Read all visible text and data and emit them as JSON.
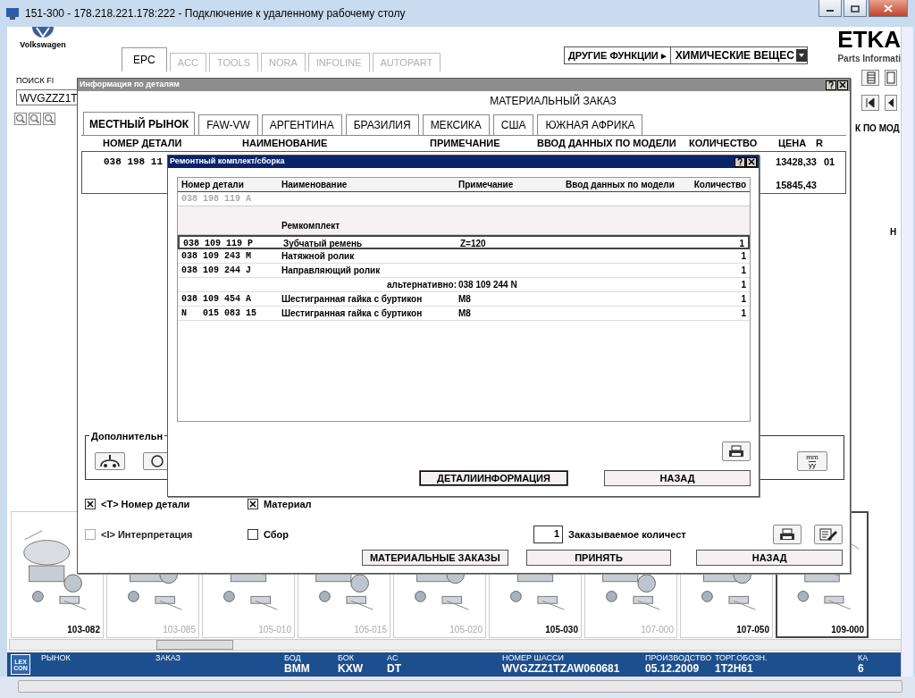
{
  "window": {
    "title": "151-300 - 178.218.221.178:222 - Подключение к удаленному рабочему столу"
  },
  "brand": {
    "name": "Volkswagen",
    "logo_text": "ETKA",
    "subtitle": "Parts Informati"
  },
  "app_tabs": [
    {
      "label": "EPC",
      "selected": true,
      "disabled": false
    },
    {
      "label": "ACC",
      "selected": false,
      "disabled": true
    },
    {
      "label": "TOOLS",
      "selected": false,
      "disabled": true
    },
    {
      "label": "NORA",
      "selected": false,
      "disabled": true
    },
    {
      "label": "INFOLINE",
      "selected": false,
      "disabled": true
    },
    {
      "label": "AUTOPART",
      "selected": false,
      "disabled": true
    }
  ],
  "other_functions": {
    "label": "ДРУГИЕ ФУНКЦИИ ▸",
    "value": "ХИМИЧЕСКИЕ ВЕЩЕС"
  },
  "search": {
    "label": "ПОИСК FI",
    "value": "WVGZZZ1T"
  },
  "right_panel": {
    "header": "К ПО МОД",
    "text": "Н"
  },
  "thumbnails": [
    {
      "label": "103-082",
      "dimmed": false,
      "selected": false
    },
    {
      "label": "103-085",
      "dimmed": true,
      "selected": false
    },
    {
      "label": "105-010",
      "dimmed": true,
      "selected": false
    },
    {
      "label": "105-015",
      "dimmed": true,
      "selected": false
    },
    {
      "label": "105-020",
      "dimmed": true,
      "selected": false
    },
    {
      "label": "105-030",
      "dimmed": false,
      "selected": false
    },
    {
      "label": "107-000",
      "dimmed": true,
      "selected": false
    },
    {
      "label": "107-050",
      "dimmed": false,
      "selected": false
    },
    {
      "label": "109-000",
      "dimmed": false,
      "selected": true
    }
  ],
  "status_bar": {
    "logo": [
      "LEX",
      "CON"
    ],
    "fields": [
      {
        "label": "РЫНОК"
      },
      {
        "label": "ЗАКАЗ"
      },
      {
        "label": "БОД",
        "value": "BMM"
      },
      {
        "label": "БОК",
        "value": "KXW"
      },
      {
        "label": "AC",
        "value": "DT"
      },
      {
        "label": "НОМЕР ШАССИ",
        "value": "WVGZZZ1TZAW060681"
      },
      {
        "label": "ПРОИЗВОДСТВО",
        "value": "05.12.2009"
      },
      {
        "label": "ТОРГ.ОБОЗН.",
        "value": "1T2H61"
      },
      {
        "label": "КА",
        "value": "6"
      }
    ]
  },
  "details_dialog": {
    "title": "Информация по деталям",
    "heading": "МАТЕРИАЛЬНЫЙ ЗАКАЗ",
    "tabs": [
      {
        "label": "МЕСТНЫЙ РЫНОК",
        "selected": true
      },
      {
        "label": "FAW-VW",
        "selected": false
      },
      {
        "label": "АРГЕНТИНА",
        "selected": false
      },
      {
        "label": "БРАЗИЛИЯ",
        "selected": false
      },
      {
        "label": "МЕКСИКА",
        "selected": false
      },
      {
        "label": "США",
        "selected": false
      },
      {
        "label": "ЮЖНАЯ АФРИКА",
        "selected": false
      }
    ],
    "columns": [
      "НОМЕР ДЕТАЛИ",
      "НАИМЕНОВАНИЕ",
      "ПРИМЕЧАНИЕ",
      "ВВОД ДАННЫХ ПО МОДЕЛИ",
      "КОЛИЧЕСТВО",
      "ЦЕНА",
      "R"
    ],
    "row": {
      "part": "038 198 11",
      "price": "13428,33",
      "r": "01"
    },
    "total": "15845,43",
    "group_label": "Дополнительн",
    "date_button": {
      "top": "mm",
      "bottom": "yy"
    },
    "checkboxes": [
      {
        "label": "<T> Номер детали",
        "checked": true,
        "disabled": false
      },
      {
        "label": "Материал",
        "checked": true,
        "disabled": false
      },
      {
        "label": "<I> Интерпретация",
        "checked": false,
        "disabled": true
      },
      {
        "label": "Сбор",
        "checked": false,
        "disabled": false
      }
    ],
    "quantity": {
      "value": "1",
      "label": "Заказываемое количест"
    },
    "buttons": [
      "МАТЕРИАЛЬНЫЕ ЗАКАЗЫ",
      "ПРИНЯТЬ",
      "НАЗАД"
    ]
  },
  "kit_dialog": {
    "title": "Ремонтный комплект/сборка",
    "columns": [
      "Номер детали",
      "Наименование",
      "Примечание",
      "Ввод данных по модели",
      "Количество"
    ],
    "rows": [
      {
        "kind": "parent",
        "part": "038 198 119 A"
      },
      {
        "kind": "group",
        "name": "Ремкомплект"
      },
      {
        "kind": "item",
        "part": "038 109 119 P",
        "name": "Зубчатый ремень",
        "note": "Z=120",
        "qty": "1",
        "selected": true
      },
      {
        "kind": "item",
        "part": "038 109 243 M",
        "name": "Натяжной ролик",
        "qty": "1",
        "selected": false
      },
      {
        "kind": "item",
        "part": "038 109 244 J",
        "name": "Направляющий ролик",
        "qty": "1",
        "selected": false
      },
      {
        "kind": "alternative",
        "name": "альтернативно:",
        "note": "038 109 244 N",
        "qty": "1",
        "selected": false
      },
      {
        "kind": "item",
        "part": "038 109 454 A",
        "name": "Шестигранная гайка с буртикон",
        "note": "M8",
        "qty": "1",
        "selected": false
      },
      {
        "kind": "item",
        "part": "N   015 083 15",
        "name": "Шестигранная гайка с буртикон",
        "note": "M8",
        "qty": "1",
        "selected": false
      }
    ],
    "buttons": [
      "ДЕТАЛИИНФОРМАЦИЯ",
      "НАЗАД"
    ]
  }
}
